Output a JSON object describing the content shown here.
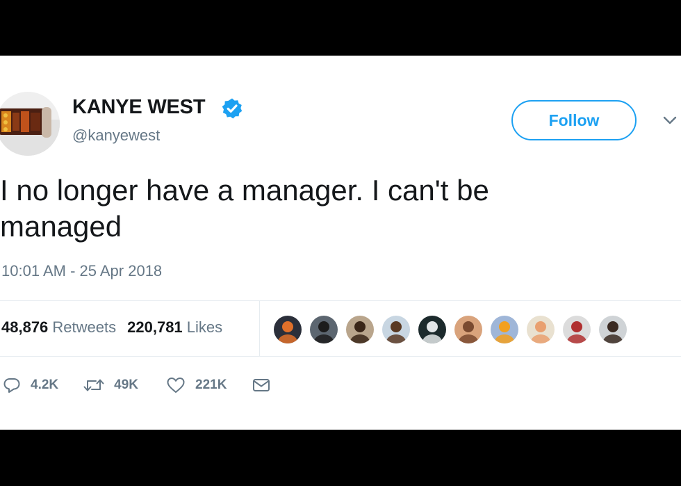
{
  "user": {
    "display_name": "KANYE WEST",
    "handle": "@kanyewest",
    "verified": true,
    "avatar_icon": "profile-photo"
  },
  "follow_button": {
    "label": "Follow"
  },
  "tweet": {
    "text": "I no longer have a manager. I can't be managed",
    "timestamp": "10:01 AM - 25 Apr 2018"
  },
  "stats": {
    "retweets_count": "48,876",
    "retweets_label": "Retweets",
    "likes_count": "220,781",
    "likes_label": "Likes"
  },
  "likers": [
    {
      "name": "liker-avatar-1",
      "bg": "#2b2f3a",
      "accent": "#e0702a"
    },
    {
      "name": "liker-avatar-2",
      "bg": "#5c6670",
      "accent": "#1c1c1c"
    },
    {
      "name": "liker-avatar-3",
      "bg": "#b9a58c",
      "accent": "#3a2618"
    },
    {
      "name": "liker-avatar-4",
      "bg": "#c8d6e2",
      "accent": "#5a3a24"
    },
    {
      "name": "liker-avatar-5",
      "bg": "#1c2a2c",
      "accent": "#e2e6e8"
    },
    {
      "name": "liker-avatar-6",
      "bg": "#d9a37c",
      "accent": "#7a4a30"
    },
    {
      "name": "liker-avatar-7",
      "bg": "#9fb6d8",
      "accent": "#f2a020"
    },
    {
      "name": "liker-avatar-8",
      "bg": "#e9e1d0",
      "accent": "#e9a070"
    },
    {
      "name": "liker-avatar-9",
      "bg": "#dcdcdc",
      "accent": "#b03030"
    },
    {
      "name": "liker-avatar-10",
      "bg": "#cfd3d6",
      "accent": "#3a2a22"
    }
  ],
  "actions": {
    "reply_count": "4.2K",
    "retweet_count": "49K",
    "like_count": "221K"
  },
  "colors": {
    "brand_blue": "#1da1f2",
    "text_primary": "#14171a",
    "text_secondary": "#657786",
    "divider": "#e6ecf0"
  }
}
